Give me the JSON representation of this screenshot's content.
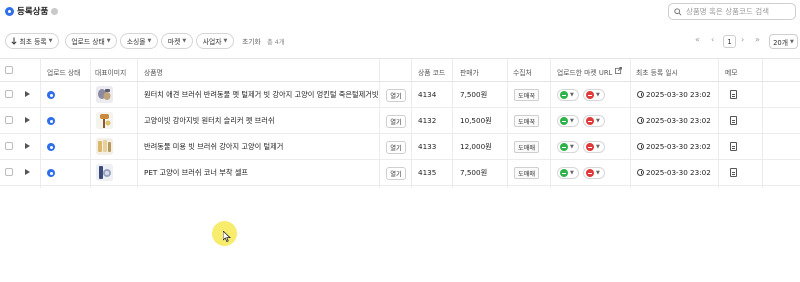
{
  "page": {
    "title": "등록상품",
    "search_placeholder": "상품명 혹은 상품코드 검색"
  },
  "filters": {
    "sort_label": "최초 등록",
    "upload_status_label": "업로드 상태",
    "sourcing_label": "소싱몰",
    "market_label": "마켓",
    "seller_label": "사업자",
    "reset_label": "초기화",
    "count_label": "총 4개",
    "current_page": "1",
    "page_size": "20개"
  },
  "columns": {
    "upload_status": "업로드 상태",
    "image": "대표이미지",
    "name": "상품명",
    "code": "상품 코드",
    "price": "판매가",
    "source": "수집처",
    "market_url": "업로드한 마켓 URL",
    "registered_at": "최초 등록 일시",
    "memo": "메모"
  },
  "rows": [
    {
      "name": "원터치 애견 브러쉬 반려동물 펫 털제거 빗 강아지 고양이 엉킨털 죽은털제거빗",
      "open": "열기",
      "code": "4134",
      "price": "7,500원",
      "source": "도매꾹",
      "registered_at": "2025-03-30 23:02"
    },
    {
      "name": "고양이빗 강아지빗 원터치 슬리커 펫 브러쉬",
      "open": "열기",
      "code": "4132",
      "price": "10,500원",
      "source": "도매꾹",
      "registered_at": "2025-03-30 23:02"
    },
    {
      "name": "반려동물 미용 빗 브러쉬 강아지 고양이 털제거",
      "open": "열기",
      "code": "4133",
      "price": "12,000원",
      "source": "도매매",
      "registered_at": "2025-03-30 23:02"
    },
    {
      "name": "PET 고양이 브러쉬 코너 부착 셀프",
      "open": "열기",
      "code": "4135",
      "price": "7,500원",
      "source": "도매매",
      "registered_at": "2025-03-30 23:02"
    }
  ],
  "colors": {
    "accent": "#2f6fed",
    "market_green": "#2fb24a",
    "market_red": "#e03a3a",
    "cursor_highlight": "#f6e63c"
  }
}
